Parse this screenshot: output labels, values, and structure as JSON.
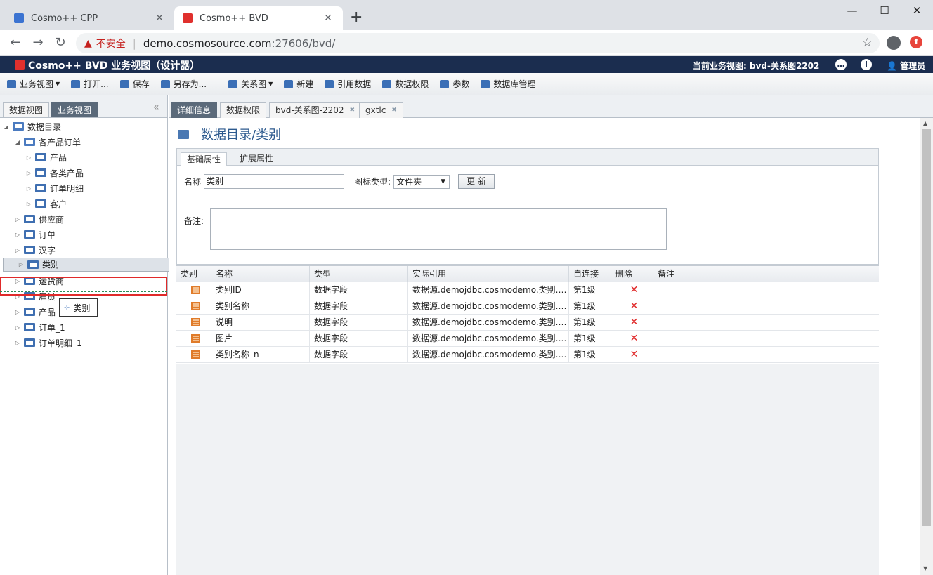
{
  "browser": {
    "tabs": [
      {
        "title": "Cosmo++ CPP",
        "close": "✕"
      },
      {
        "title": "Cosmo++ BVD",
        "close": "✕"
      }
    ],
    "new_tab": "+",
    "insecure_label": "不安全",
    "url_host": "demo.cosmosource.com",
    "url_path": ":27606/bvd/",
    "window_controls": [
      "—",
      "☐",
      "✕"
    ]
  },
  "app": {
    "title": "Cosmo++ BVD 业务视图（设计器）",
    "current_view": "当前业务视图: bvd-关系图2202",
    "user": "管理员",
    "accent_color": "#1b2d4f"
  },
  "toolbar": {
    "items": [
      {
        "label": "业务视图",
        "icon": "business-view-icon",
        "dropdown": true
      },
      {
        "label": "打开...",
        "icon": "open-icon"
      },
      {
        "label": "保存",
        "icon": "save-icon"
      },
      {
        "label": "另存为...",
        "icon": "save-as-icon"
      },
      {
        "label": "关系图",
        "icon": "relation-icon",
        "dropdown": true
      },
      {
        "label": "新建",
        "icon": "new-icon"
      },
      {
        "label": "引用数据",
        "icon": "reference-data-icon"
      },
      {
        "label": "数据权限",
        "icon": "data-permission-icon"
      },
      {
        "label": "参数",
        "icon": "parameter-icon"
      },
      {
        "label": "数据库管理",
        "icon": "database-icon"
      }
    ]
  },
  "left": {
    "tabs": [
      "数据视图",
      "业务视图"
    ],
    "tree": [
      {
        "label": "数据目录",
        "level": 0,
        "expanded": true
      },
      {
        "label": "各产品订单",
        "level": 1,
        "expanded": true
      },
      {
        "label": "产品",
        "level": 2
      },
      {
        "label": "各类产品",
        "level": 2
      },
      {
        "label": "订单明细",
        "level": 2
      },
      {
        "label": "客户",
        "level": 2
      },
      {
        "label": "供应商",
        "level": 1
      },
      {
        "label": "订单",
        "level": 1
      },
      {
        "label": "汉字",
        "level": 1
      },
      {
        "label": "类别",
        "level": 1,
        "selected": true
      },
      {
        "label": "运货商",
        "level": 1
      },
      {
        "label": "雇员",
        "level": 1
      },
      {
        "label": "产品",
        "level": 1
      },
      {
        "label": "订单_1",
        "level": 1
      },
      {
        "label": "订单明细_1",
        "level": 1
      }
    ],
    "drag_label": "类别"
  },
  "content": {
    "tabs": [
      {
        "label": "详细信息",
        "closable": false
      },
      {
        "label": "数据权限",
        "closable": false
      },
      {
        "label": "bvd-关系图-2202",
        "closable": true
      },
      {
        "label": "gxtlc",
        "closable": true
      }
    ],
    "title": "数据目录/类别",
    "form_tabs": [
      "基础属性",
      "扩展属性"
    ],
    "name_label": "名称",
    "name_value": "类别",
    "icon_type_label": "图标类型:",
    "icon_type_value": "文件夹",
    "update_button": "更 新",
    "remark_label": "备注:",
    "grid": {
      "columns": [
        "类别",
        "名称",
        "类型",
        "实际引用",
        "自连接",
        "删除",
        "备注"
      ],
      "rows": [
        {
          "name": "类别ID",
          "type": "数据字段",
          "ref": "数据源.demojdbc.cosmodemo.类别.类...",
          "self_join": "第1级"
        },
        {
          "name": "类别名称",
          "type": "数据字段",
          "ref": "数据源.demojdbc.cosmodemo.类别.类...",
          "self_join": "第1级"
        },
        {
          "name": "说明",
          "type": "数据字段",
          "ref": "数据源.demojdbc.cosmodemo.类别.说明",
          "self_join": "第1级"
        },
        {
          "name": "图片",
          "type": "数据字段",
          "ref": "数据源.demojdbc.cosmodemo.类别.图片",
          "self_join": "第1级"
        },
        {
          "name": "类别名称_n",
          "type": "数据字段",
          "ref": "数据源.demojdbc.cosmodemo.类别.类...",
          "self_join": "第1级"
        }
      ]
    }
  }
}
